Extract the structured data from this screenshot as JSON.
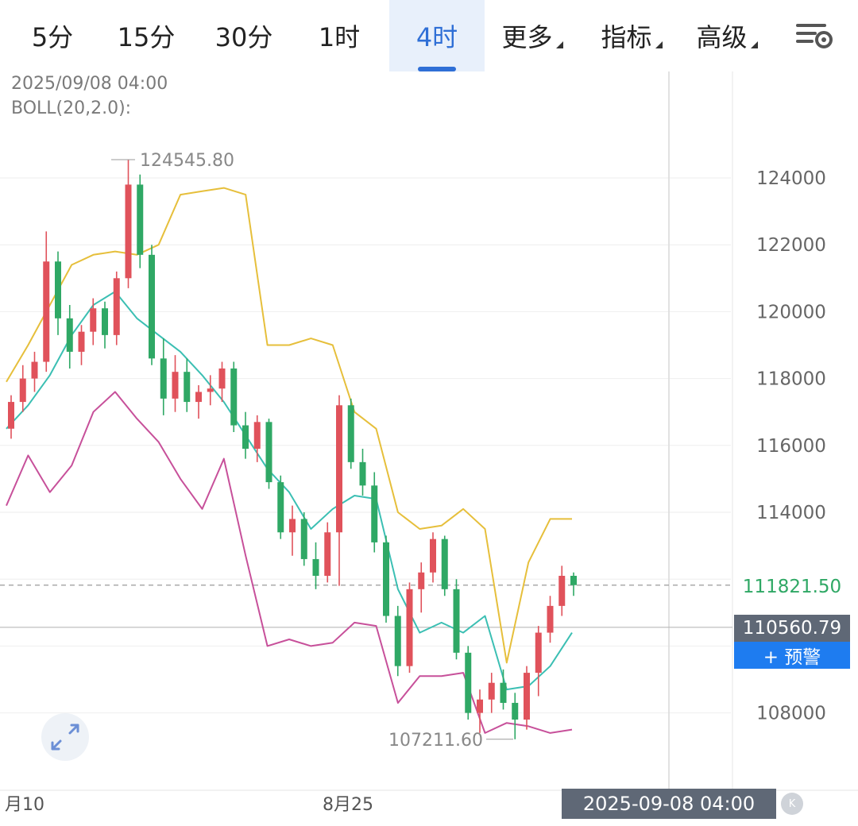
{
  "toolbar": {
    "tabs": [
      {
        "label": "5分",
        "active": false
      },
      {
        "label": "15分",
        "active": false
      },
      {
        "label": "30分",
        "active": false
      },
      {
        "label": "1时",
        "active": false
      },
      {
        "label": "4时",
        "active": true
      },
      {
        "label": "更多",
        "active": false,
        "dropdown": true
      },
      {
        "label": "指标",
        "active": false,
        "dropdown": true
      },
      {
        "label": "高级",
        "active": false,
        "dropdown": true
      }
    ],
    "settings_icon": "chart-settings-icon"
  },
  "info": {
    "datetime": "2025/09/08 04:00",
    "indicator": "BOLL(20,2.0):"
  },
  "price_labels": {
    "current_price": "111821.50",
    "crosshair_price": "110560.79",
    "alert_button": "+ 预警"
  },
  "time_badge": "2025-09-08 04:00",
  "k_icon": "K",
  "expand_icon": "expand-icon",
  "colors": {
    "up": "#e0525b",
    "down": "#2fa865",
    "boll_upper": "#e6bf3b",
    "boll_mid": "#3bbfb3",
    "boll_lower": "#c7509a",
    "accent": "#2f6fd6",
    "current_price": "#2fa865"
  },
  "chart_data": {
    "type": "candlestick",
    "y_ticks": [
      108000,
      110000,
      112000,
      114000,
      116000,
      118000,
      120000,
      122000,
      124000
    ],
    "y_tick_labels": [
      "108000",
      "114000",
      "116000",
      "118000",
      "120000",
      "122000",
      "124000"
    ],
    "x_labels": [
      "月10",
      "8月25"
    ],
    "ylim": [
      106000,
      126000
    ],
    "annotations": {
      "high": "124545.80",
      "low": "107211.60"
    },
    "series": [
      {
        "name": "upper",
        "role": "boll",
        "y": [
          117900,
          119000,
          120200,
          121400,
          121700,
          121800,
          121700,
          122000,
          123500,
          123600,
          123700,
          123500,
          119000,
          119000,
          119200,
          119000,
          117000,
          116500,
          114000,
          113500,
          113600,
          114100,
          113500,
          109500,
          112500,
          113800,
          113800
        ]
      },
      {
        "name": "mid",
        "role": "boll",
        "y": [
          116500,
          117200,
          118100,
          119300,
          120200,
          120600,
          119800,
          119300,
          118800,
          118100,
          117300,
          116300,
          115300,
          114600,
          113500,
          114100,
          114500,
          114400,
          111700,
          110400,
          110700,
          110400,
          110900,
          108700,
          108800,
          109400,
          110400
        ]
      },
      {
        "name": "lower",
        "role": "boll",
        "y": [
          114200,
          115700,
          114600,
          115400,
          117000,
          117600,
          116800,
          116100,
          115000,
          114100,
          115600,
          112700,
          110000,
          110200,
          110000,
          110100,
          110700,
          110600,
          108300,
          109100,
          109100,
          109200,
          107400,
          107700,
          107600,
          107400,
          107500
        ]
      },
      {
        "name": "candles",
        "role": "ohlc",
        "data": [
          [
            116500,
            117500,
            116200,
            117300
          ],
          [
            117300,
            118400,
            117000,
            118000
          ],
          [
            118000,
            118800,
            117600,
            118500
          ],
          [
            118500,
            122400,
            118200,
            121500
          ],
          [
            121500,
            121800,
            119300,
            119800
          ],
          [
            119800,
            120200,
            118300,
            118800
          ],
          [
            118800,
            119600,
            118400,
            119400
          ],
          [
            119400,
            120400,
            119000,
            120100
          ],
          [
            120100,
            120300,
            118900,
            119300
          ],
          [
            119300,
            121200,
            119000,
            121000
          ],
          [
            121000,
            124545.8,
            120700,
            123800
          ],
          [
            123800,
            124100,
            121300,
            121700
          ],
          [
            121700,
            122000,
            118400,
            118600
          ],
          [
            118600,
            119200,
            116900,
            117400
          ],
          [
            117400,
            118700,
            117000,
            118200
          ],
          [
            118200,
            118600,
            117000,
            117300
          ],
          [
            117300,
            117800,
            116800,
            117600
          ],
          [
            117600,
            118100,
            117200,
            117700
          ],
          [
            117700,
            118500,
            117300,
            118300
          ],
          [
            118300,
            118500,
            116400,
            116600
          ],
          [
            116600,
            117000,
            115600,
            115900
          ],
          [
            115900,
            116900,
            115500,
            116700
          ],
          [
            116700,
            116800,
            114700,
            114900
          ],
          [
            114900,
            115100,
            113200,
            113400
          ],
          [
            113400,
            114200,
            112700,
            113800
          ],
          [
            113800,
            114000,
            112400,
            112600
          ],
          [
            112600,
            113100,
            111700,
            112100
          ],
          [
            112100,
            113700,
            111900,
            113400
          ],
          [
            113400,
            117500,
            111800,
            117200
          ],
          [
            117200,
            117400,
            115300,
            115500
          ],
          [
            115500,
            115900,
            114500,
            114800
          ],
          [
            114800,
            115200,
            112800,
            113100
          ],
          [
            113100,
            113300,
            110700,
            110900
          ],
          [
            110900,
            111200,
            109100,
            109400
          ],
          [
            109400,
            111900,
            109200,
            111700
          ],
          [
            111700,
            112500,
            111000,
            112200
          ],
          [
            112200,
            113400,
            111900,
            113200
          ],
          [
            113200,
            113300,
            111500,
            111700
          ],
          [
            111700,
            112000,
            109600,
            109800
          ],
          [
            109800,
            110000,
            107800,
            108000
          ],
          [
            108000,
            108700,
            107400,
            108400
          ],
          [
            108400,
            109200,
            108000,
            108900
          ],
          [
            108900,
            109300,
            108100,
            108300
          ],
          [
            108300,
            108600,
            107211.6,
            107800
          ],
          [
            107800,
            109400,
            107500,
            109200
          ],
          [
            109200,
            110600,
            108500,
            110400
          ],
          [
            110400,
            111500,
            110100,
            111200
          ],
          [
            111200,
            112400,
            110900,
            112100
          ],
          [
            112100,
            112200,
            111500,
            111821.5
          ]
        ]
      }
    ]
  }
}
